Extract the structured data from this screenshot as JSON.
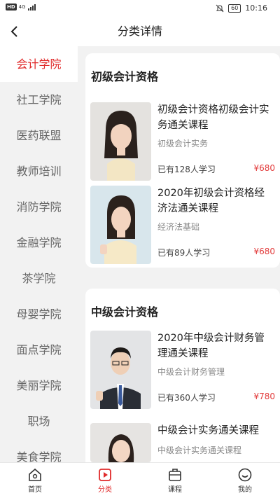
{
  "status": {
    "carrier": "HD",
    "network": "4G",
    "battery": "60",
    "time": "10:16"
  },
  "nav": {
    "title": "分类详情"
  },
  "sidebar": {
    "items": [
      {
        "label": "会计学院",
        "active": true
      },
      {
        "label": "社工学院"
      },
      {
        "label": "医药联盟"
      },
      {
        "label": "教师培训"
      },
      {
        "label": "消防学院"
      },
      {
        "label": "金融学院"
      },
      {
        "label": "茶学院"
      },
      {
        "label": "母婴学院"
      },
      {
        "label": "面点学院"
      },
      {
        "label": "美丽学院"
      },
      {
        "label": "职场"
      },
      {
        "label": "美食学院"
      }
    ]
  },
  "sections": [
    {
      "title": "初级会计资格",
      "courses": [
        {
          "title": "初级会计资格初级会计实务通关课程",
          "subtitle": "初级会计实务",
          "students": "已有128人学习",
          "price": "¥680"
        },
        {
          "title": "2020年初级会计资格经济法通关课程",
          "subtitle": "经济法基础",
          "students": "已有89人学习",
          "price": "¥680"
        }
      ]
    },
    {
      "title": "中级会计资格",
      "courses": [
        {
          "title": "2020年中级会计财务管理通关课程",
          "subtitle": "中级会计财务管理",
          "students": "已有360人学习",
          "price": "¥780"
        },
        {
          "title": "中级会计实务通关课程",
          "subtitle": "中级会计实务通关课程",
          "students": "",
          "price": ""
        }
      ]
    }
  ],
  "tabbar": [
    {
      "label": "首页",
      "icon": "home-icon"
    },
    {
      "label": "分类",
      "icon": "category-icon",
      "active": true
    },
    {
      "label": "课程",
      "icon": "course-icon"
    },
    {
      "label": "我的",
      "icon": "profile-icon"
    }
  ],
  "colors": {
    "accent": "#e02a2a",
    "price": "#e23b3b"
  }
}
